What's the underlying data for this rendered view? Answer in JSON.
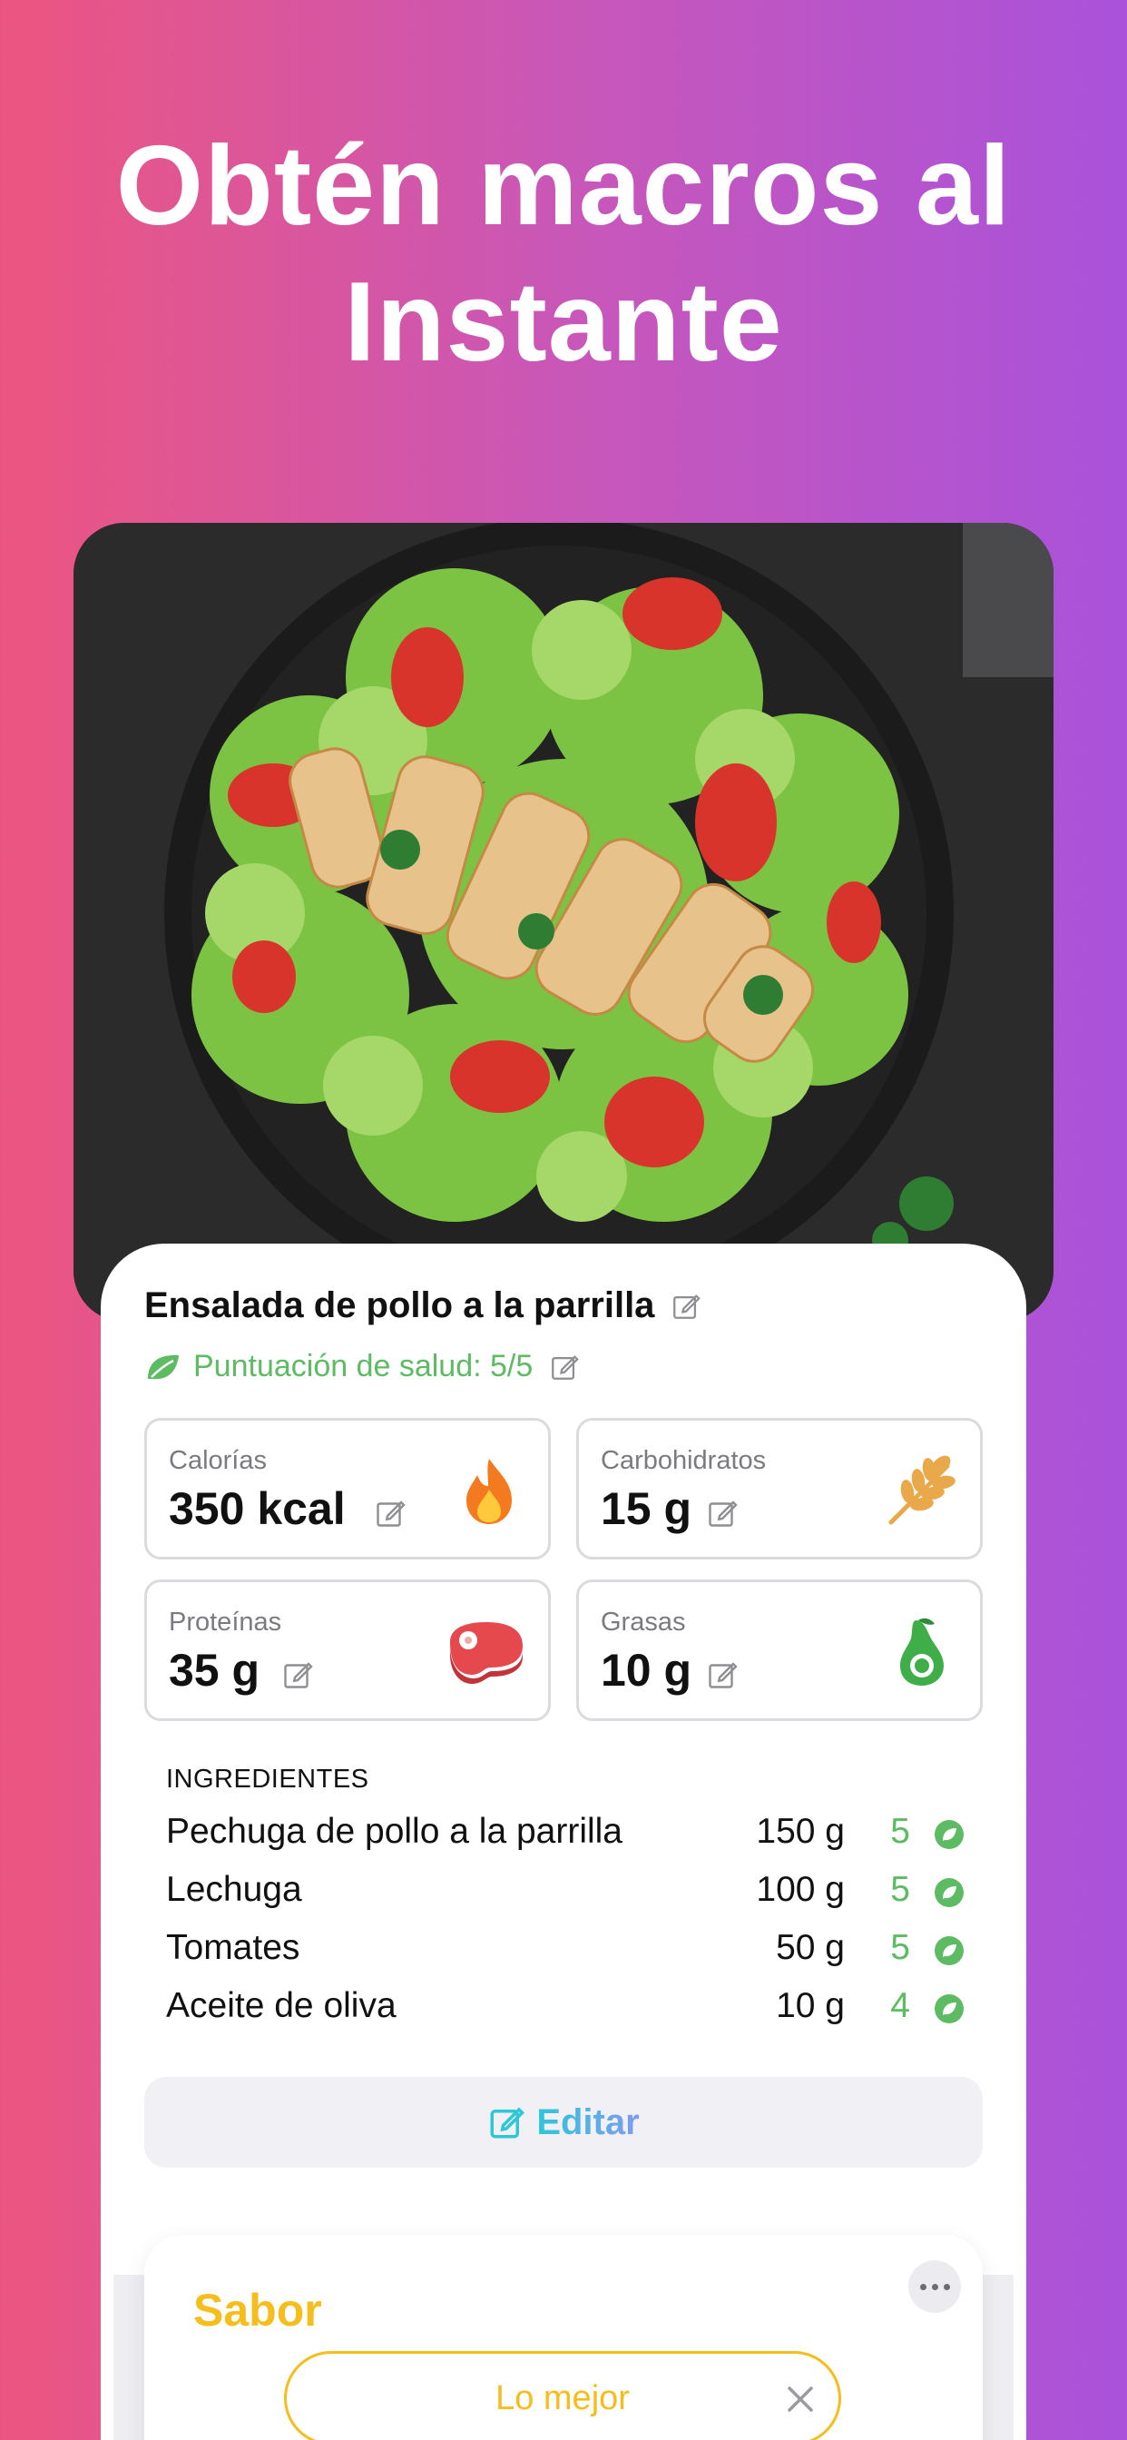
{
  "headline": {
    "line1": "Obtén macros al",
    "line2": "Instante"
  },
  "dish": {
    "title": "Ensalada de pollo a la parrilla",
    "health_score": "Puntuación de salud: 5/5"
  },
  "macros": [
    {
      "label": "Calorías",
      "value": "350 kcal",
      "icon": "flame-icon"
    },
    {
      "label": "Carbohidratos",
      "value": "15 g",
      "icon": "wheat-icon"
    },
    {
      "label": "Proteínas",
      "value": "35 g",
      "icon": "steak-icon"
    },
    {
      "label": "Grasas",
      "value": "10 g",
      "icon": "avocado-icon"
    }
  ],
  "ingredients": {
    "header": "INGREDIENTES",
    "items": [
      {
        "name": "Pechuga de pollo a la parrilla",
        "qty": "150 g",
        "score": "5"
      },
      {
        "name": "Lechuga",
        "qty": "100 g",
        "score": "5"
      },
      {
        "name": "Tomates",
        "qty": "50 g",
        "score": "5"
      },
      {
        "name": "Aceite de oliva",
        "qty": "10 g",
        "score": "4"
      }
    ]
  },
  "edit_button": {
    "label": "Editar"
  },
  "flavor": {
    "title": "Sabor",
    "selected": "Lo mejor"
  },
  "colors": {
    "health_green": "#5DBB63",
    "flavor_yellow": "#F5BE1C",
    "edit_gradient_start": "#2FC6D8",
    "edit_gradient_end": "#7F9BF0",
    "bg_gradient_start": "#EC5580",
    "bg_gradient_end": "#A952DB"
  }
}
